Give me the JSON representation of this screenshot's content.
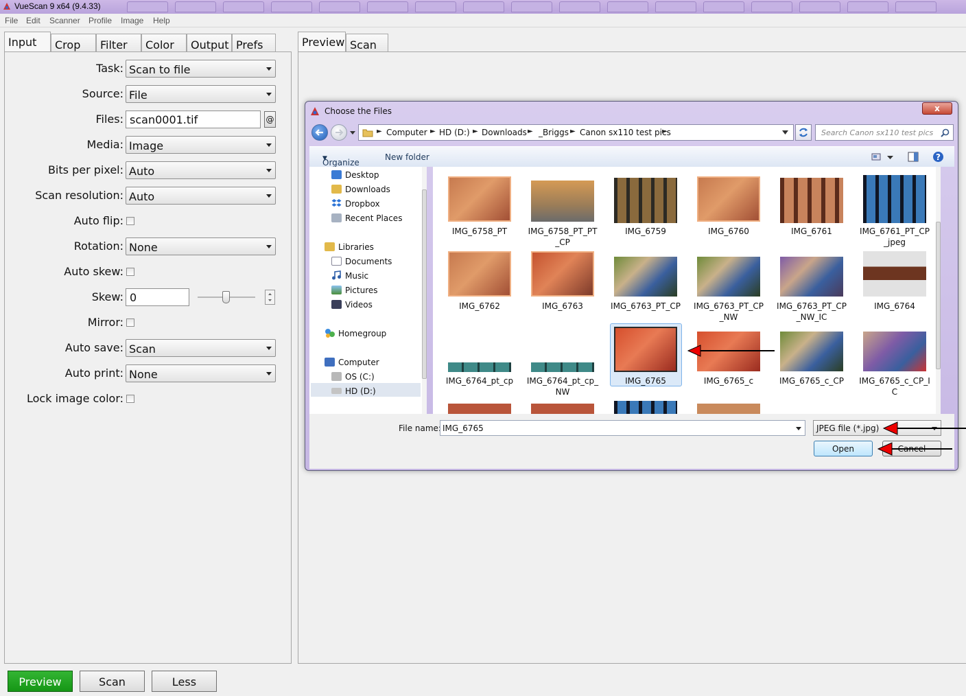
{
  "app": {
    "title": "VueScan 9 x64 (9.4.33)"
  },
  "menu": [
    "File",
    "Edit",
    "Scanner",
    "Profile",
    "Image",
    "Help"
  ],
  "left_tabs": [
    "Input",
    "Crop",
    "Filter",
    "Color",
    "Output",
    "Prefs"
  ],
  "right_tabs": [
    "Preview",
    "Scan"
  ],
  "input": {
    "task_label": "Task:",
    "task_value": "Scan to file",
    "source_label": "Source:",
    "source_value": "File",
    "files_label": "Files:",
    "files_value": "scan0001.tif",
    "files_btn": "@",
    "media_label": "Media:",
    "media_value": "Image",
    "bpp_label": "Bits per pixel:",
    "bpp_value": "Auto",
    "res_label": "Scan resolution:",
    "res_value": "Auto",
    "autoflip_label": "Auto flip:",
    "rotation_label": "Rotation:",
    "rotation_value": "None",
    "autoskew_label": "Auto skew:",
    "skew_label": "Skew:",
    "skew_value": "0",
    "mirror_label": "Mirror:",
    "autosave_label": "Auto save:",
    "autosave_value": "Scan",
    "autoprint_label": "Auto print:",
    "autoprint_value": "None",
    "lockcolor_label": "Lock image color:"
  },
  "bottom_buttons": {
    "preview": "Preview",
    "scan": "Scan",
    "less": "Less"
  },
  "dialog": {
    "title": "Choose the Files",
    "close": "x",
    "breadcrumb": [
      "Computer",
      "HD (D:)",
      "Downloads",
      "_Briggs",
      "Canon sx110 test pics"
    ],
    "search_placeholder": "Search Canon sx110 test pics",
    "organize": "Organize",
    "new_folder": "New folder",
    "nav": {
      "favorites": [
        "Desktop",
        "Downloads",
        "Dropbox",
        "Recent Places"
      ],
      "libraries": "Libraries",
      "library_items": [
        "Documents",
        "Music",
        "Pictures",
        "Videos"
      ],
      "homegroup": "Homegroup",
      "computer": "Computer",
      "drives": [
        "OS (C:)",
        "HD (D:)"
      ]
    },
    "files": [
      [
        "IMG_6758_PT",
        "IMG_6758_PT_PT\n_CP",
        "IMG_6759",
        "IMG_6760",
        "IMG_6761",
        "IMG_6761_PT_CP\n_jpeg"
      ],
      [
        "IMG_6762",
        "IMG_6763",
        "IMG_6763_PT_CP",
        "IMG_6763_PT_CP\n_NW",
        "IMG_6763_PT_CP\n_NW_IC",
        "IMG_6764"
      ],
      [
        "IMG_6764_pt_cp",
        "IMG_6764_pt_cp_\nNW",
        "IMG_6765",
        "IMG_6765_c",
        "IMG_6765_c_CP",
        "IMG_6765_c_CP_I\nC"
      ]
    ],
    "selected_file": "IMG_6765",
    "filename_label": "File name:",
    "filename_value": "IMG_6765",
    "filetype_value": "JPEG file (*.jpg)",
    "open": "Open",
    "cancel": "Cancel"
  }
}
